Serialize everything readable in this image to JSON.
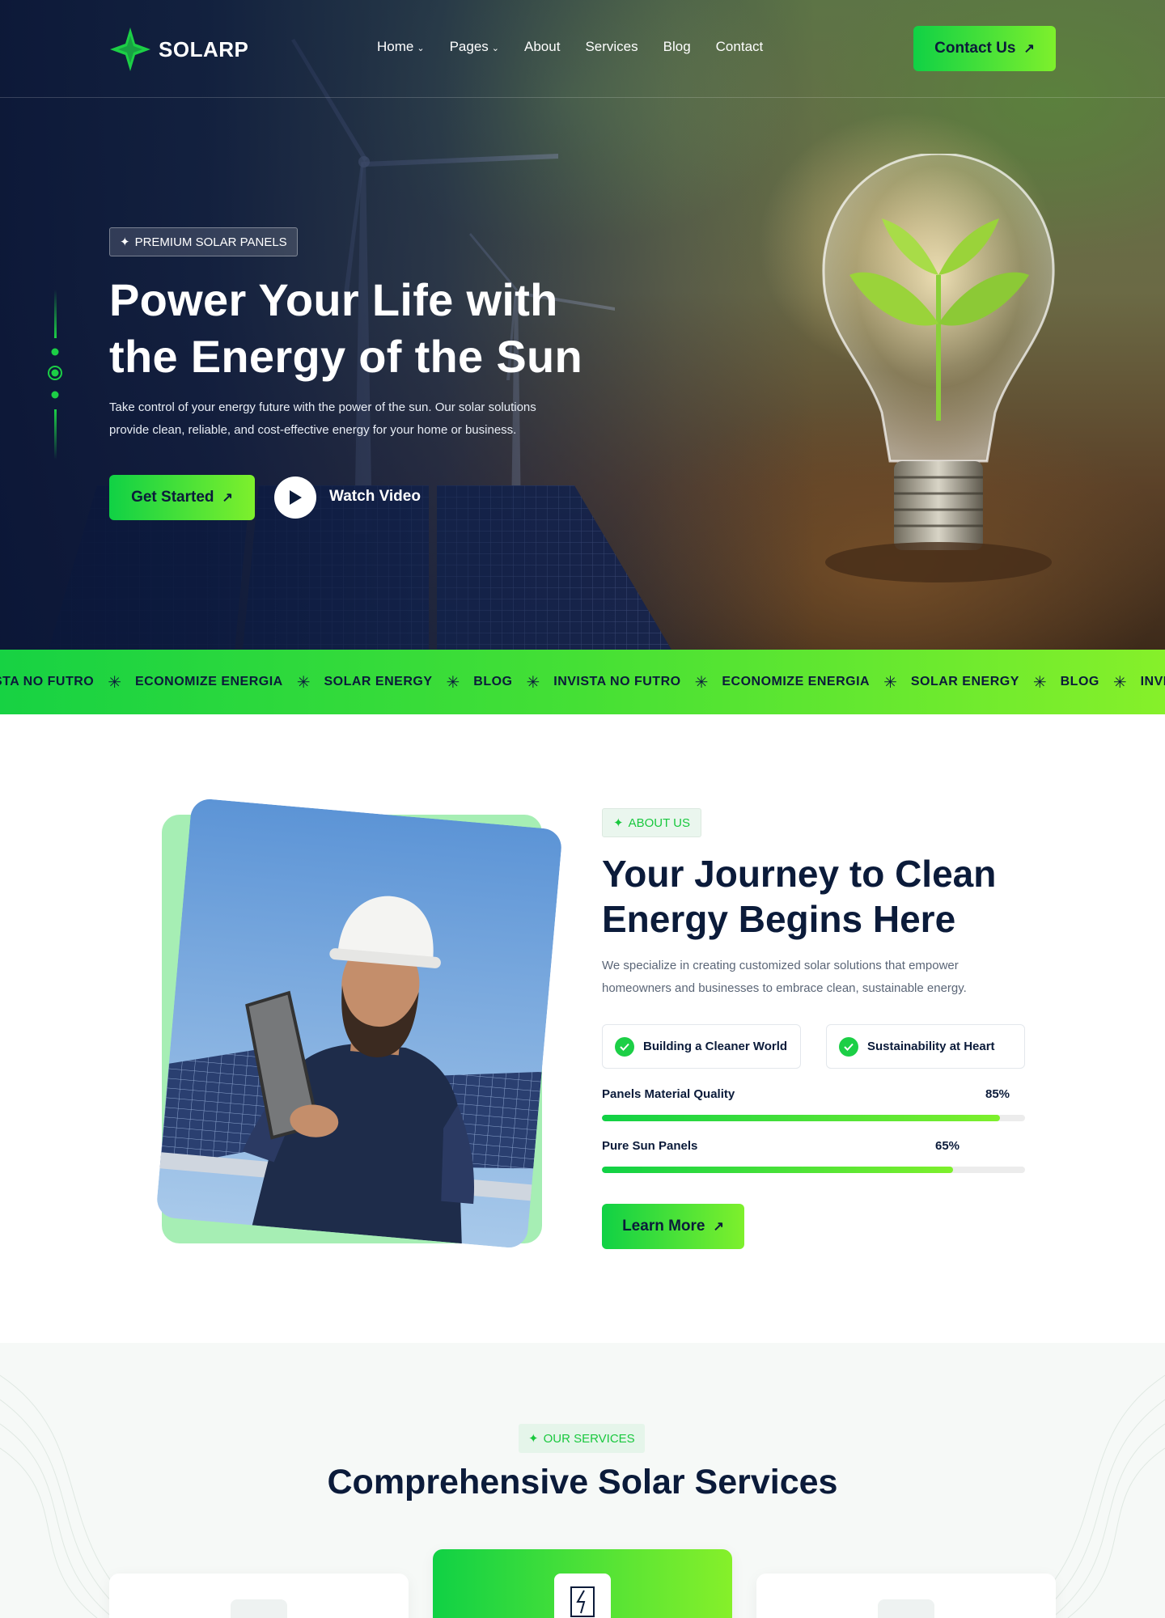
{
  "brand": {
    "name": "SOLARP",
    "accent": "#1ccf46",
    "accent_end": "#7ef02c",
    "navy": "#0b1b3a"
  },
  "nav": {
    "items": [
      {
        "label": "Home",
        "dropdown": true
      },
      {
        "label": "Pages",
        "dropdown": true
      },
      {
        "label": "About",
        "dropdown": false
      },
      {
        "label": "Services",
        "dropdown": false
      },
      {
        "label": "Blog",
        "dropdown": false
      },
      {
        "label": "Contact",
        "dropdown": false
      }
    ],
    "cta": "Contact Us"
  },
  "hero": {
    "badge": "PREMIUM SOLAR PANELS",
    "title_line1": "Power Your Life with",
    "title_line2": "the Energy of the Sun",
    "desc_line1": "Take control of your energy future with the power of the sun. Our solar solutions",
    "desc_line2": "provide clean, reliable, and cost-effective energy for your home or business.",
    "primary_cta": "Get Started",
    "video_cta": "Watch Video"
  },
  "ticker": {
    "items": [
      "STA NO FUTRO",
      "ECONOMIZE ENERGIA",
      "SOLAR ENERGY",
      "BLOG",
      "INVISTA NO FUTRO",
      "ECONOMIZE ENERGIA",
      "SOLAR ENERGY",
      "BLOG",
      "INVISTA NO"
    ]
  },
  "about": {
    "badge": "ABOUT US",
    "title_line1": "Your Journey to Clean",
    "title_line2": "Energy Begins Here",
    "desc_line1": "We specialize in creating customized solar solutions that empower",
    "desc_line2": "homeowners and businesses to embrace clean, sustainable energy.",
    "features": [
      "Building a Cleaner World",
      "Sustainability at Heart"
    ],
    "progress": [
      {
        "label": "Panels Material Quality",
        "value_text": "85%",
        "value": 0.94
      },
      {
        "label": "Pure Sun Panels",
        "value_text": "65%",
        "value": 0.83
      }
    ],
    "cta": "Learn More"
  },
  "services": {
    "badge": "OUR SERVICES",
    "title": "Comprehensive Solar Services",
    "cards": [
      {
        "icon": "gear-solar-icon"
      },
      {
        "icon": "energy-panel-icon"
      },
      {
        "icon": "solar-house-icon"
      }
    ]
  }
}
